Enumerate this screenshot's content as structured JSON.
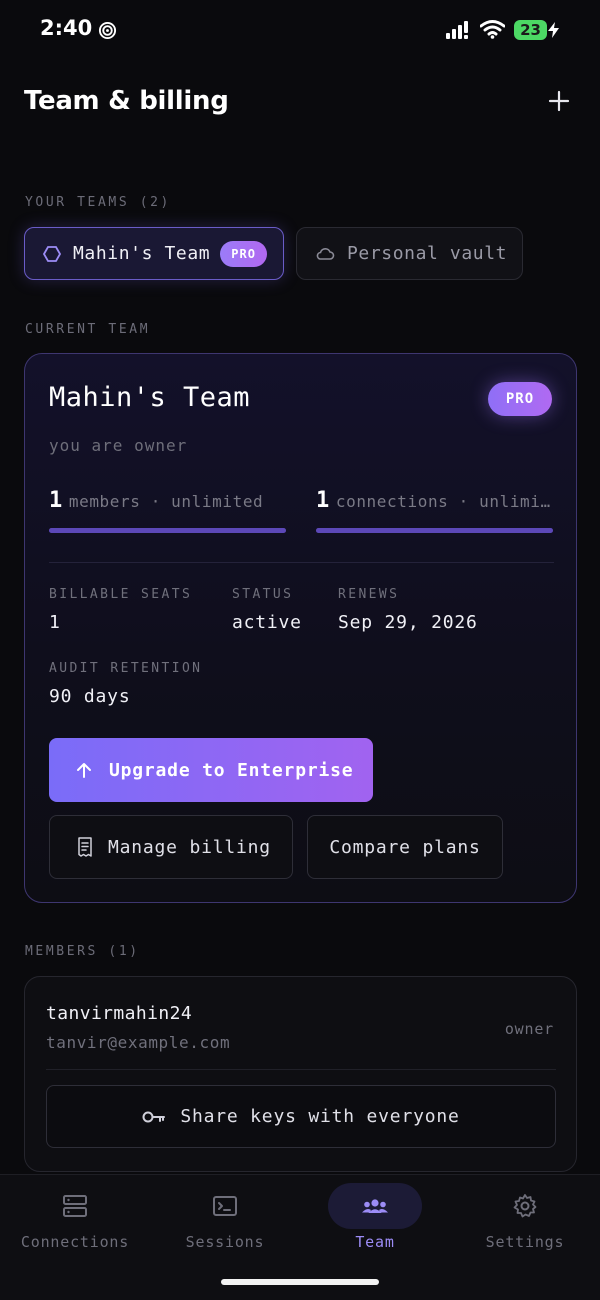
{
  "status_bar": {
    "time": "2:40",
    "battery": "23"
  },
  "header": {
    "title": "Team & billing"
  },
  "teams": {
    "section_label": "YOUR TEAMS (2)",
    "items": [
      {
        "label": "Mahin's Team",
        "badge": "PRO",
        "active": true
      },
      {
        "label": "Personal vault",
        "active": false
      }
    ]
  },
  "current_team": {
    "section_label": "CURRENT TEAM",
    "name": "Mahin's Team",
    "badge": "PRO",
    "role": "you are owner",
    "usage": [
      {
        "count": "1",
        "label": "members · unlimited"
      },
      {
        "count": "1",
        "label": "connections · unlimited"
      }
    ],
    "stats": {
      "billable_seats_label": "BILLABLE SEATS",
      "billable_seats_value": "1",
      "status_label": "STATUS",
      "status_value": "active",
      "renews_label": "RENEWS",
      "renews_value": "Sep 29, 2026",
      "audit_label": "AUDIT RETENTION",
      "audit_value": "90 days"
    },
    "upgrade_label": "Upgrade to Enterprise",
    "manage_billing_label": "Manage billing",
    "compare_plans_label": "Compare plans"
  },
  "members": {
    "section_label": "MEMBERS (1)",
    "items": [
      {
        "username": "tanvirmahin24",
        "email": "tanvir@example.com",
        "role": "owner"
      }
    ],
    "share_label": "Share keys with everyone"
  },
  "bottom_nav": {
    "items": [
      {
        "label": "Connections",
        "icon": "server-icon"
      },
      {
        "label": "Sessions",
        "icon": "terminal-icon"
      },
      {
        "label": "Team",
        "icon": "users-icon",
        "active": true
      },
      {
        "label": "Settings",
        "icon": "gear-icon"
      }
    ]
  },
  "colors": {
    "accent": "#9c8cf6",
    "pro_gradient_start": "#8f6ff6",
    "pro_gradient_end": "#b06af2",
    "background": "#0a0a0d"
  }
}
